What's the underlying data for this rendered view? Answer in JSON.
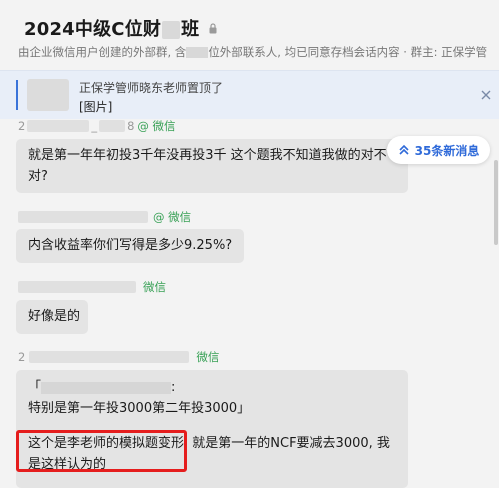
{
  "header": {
    "title_prefix": "2024中级C位财",
    "title_suffix": "班",
    "subtitle_part1": "由企业微信用户创建的外部群, 含",
    "subtitle_part2": "位外部联系人, 均已同意存档会话内容",
    "subtitle_part3": "· 群主: 正保学管",
    "icons": [
      "lock-icon"
    ]
  },
  "pinned": {
    "text": "正保学管师晓东老师置顶了",
    "content": "[图片]",
    "icons": [
      "close-icon"
    ]
  },
  "new_messages": {
    "label": "35条新消息",
    "icon": "double-chevron-up-icon"
  },
  "messages": [
    {
      "sender_partial": "2",
      "sender_partial2": "_",
      "sender_partial3": "8",
      "tag": "@ 微信",
      "lines": [
        "就是第一年年初投3千年没再投3千 这个题我不知道我做的对不",
        "对?"
      ]
    },
    {
      "tag": "@ 微信",
      "lines": [
        "内含收益率你们写得是多少9.25%?"
      ]
    },
    {
      "tag": "微信",
      "lines": [
        "好像是的"
      ]
    },
    {
      "sender_partial": "2",
      "tag": "微信",
      "quote_open": "「",
      "quote_colon": ":",
      "lines": [
        "特别是第一年投3000第二年投3000」",
        "这个是李老师的模拟题变形",
        "就是第一年的NCF要减去3000, 我",
        "是这样认为的"
      ]
    }
  ],
  "colors": {
    "accent": "#2f6ad9",
    "wechat_tag": "#37a055",
    "highlight": "#e51d1d"
  }
}
